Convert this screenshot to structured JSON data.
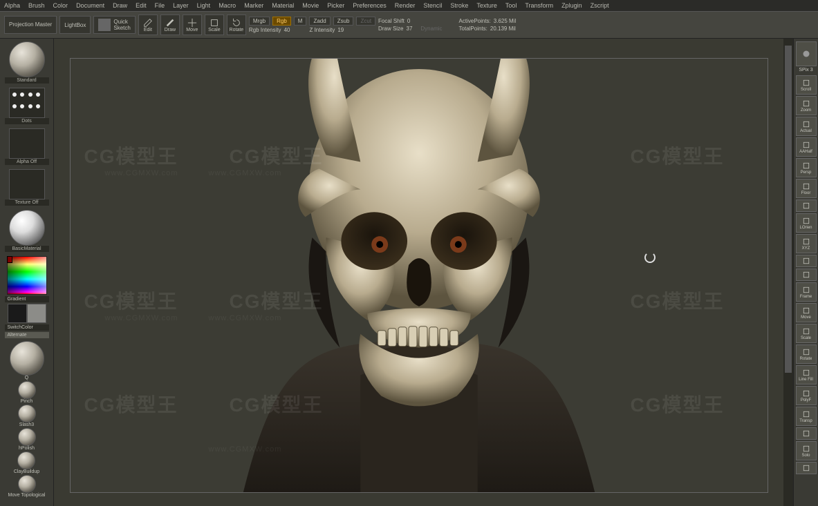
{
  "menu": [
    "Alpha",
    "Brush",
    "Color",
    "Document",
    "Draw",
    "Edit",
    "File",
    "Layer",
    "Light",
    "Macro",
    "Marker",
    "Material",
    "Movie",
    "Picker",
    "Preferences",
    "Render",
    "Stencil",
    "Stroke",
    "Texture",
    "Tool",
    "Transform",
    "Zplugin",
    "Zscript"
  ],
  "toolbar": {
    "projection": "Projection\nMaster",
    "lightbox": "LightBox",
    "quicksketch": "Quick\nSketch",
    "edit": "Edit",
    "draw": "Draw",
    "move": "Move",
    "scale": "Scale",
    "rotate": "Rotate"
  },
  "params": {
    "mrgb": "Mrgb",
    "rgb": "Rgb",
    "m": "M",
    "rgb_intensity_label": "Rgb Intensity",
    "rgb_intensity_val": "40",
    "zadd": "Zadd",
    "zsub": "Zsub",
    "zcut": "Zcut",
    "z_intensity_label": "Z Intensity",
    "z_intensity_val": "19",
    "focal_label": "Focal Shift",
    "focal_val": "0",
    "draw_size_label": "Draw Size",
    "draw_size_val": "37",
    "dynamic": "Dynamic",
    "activepoints_label": "ActivePoints:",
    "activepoints_val": "3.625 Mil",
    "totalpoints_label": "TotalPoints:",
    "totalpoints_val": "20.139 Mil"
  },
  "left": {
    "brush_name": "Standard",
    "stroke_name": "Dots",
    "alpha": "Alpha Off",
    "texture": "Texture Off",
    "material": "BasicMaterial",
    "gradient": "Gradient",
    "switchcolor": "SwitchColor",
    "alternate": "Alternate",
    "brushes": [
      "Q",
      "Pinch",
      "Slash3",
      "hPolish",
      "ClayBuildup",
      "Move Topological"
    ]
  },
  "right": {
    "spix": "SPix 3",
    "buttons": [
      "Scroll",
      "Zoom",
      "Actual",
      "AAHalf",
      "Persp",
      "Floor",
      "",
      "LOrien",
      "XYZ",
      "",
      "",
      "Frame",
      "Move",
      "Scale",
      "Rotate",
      "Line Fill",
      "PolyF",
      "Transp",
      "",
      "Solo",
      ""
    ]
  },
  "watermarks": {
    "big": "CG模型王",
    "url": "www.CGMXW.com"
  },
  "model_description": "Demon skull bust with horns and hooded cloak"
}
